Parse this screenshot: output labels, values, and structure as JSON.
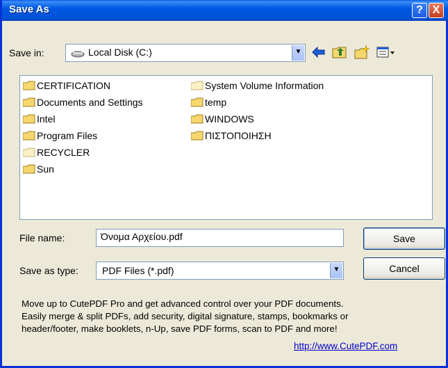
{
  "title": "Save As",
  "titlebar_buttons": {
    "help": "?",
    "close": "X"
  },
  "save_in": {
    "label": "Save in:",
    "value": "Local Disk (C:)"
  },
  "toolbar_icons": [
    "back-arrow-icon",
    "up-one-level-icon",
    "new-folder-icon",
    "view-menu-icon"
  ],
  "folders": [
    {
      "name": "CERTIFICATION"
    },
    {
      "name": "Documents and Settings"
    },
    {
      "name": "Intel"
    },
    {
      "name": "Program Files"
    },
    {
      "name": "RECYCLER"
    },
    {
      "name": "Sun"
    },
    {
      "name": "System Volume Information"
    },
    {
      "name": "temp"
    },
    {
      "name": "WINDOWS"
    },
    {
      "name": "ΠΙΣΤΟΠΟΙΗΣΗ"
    }
  ],
  "file_name": {
    "label": "File name:",
    "value": "Όνομα Αρχείου.pdf"
  },
  "save_as_type": {
    "label": "Save as type:",
    "value": "PDF Files (*.pdf)"
  },
  "buttons": {
    "save": "Save",
    "cancel": "Cancel"
  },
  "info": {
    "line1": "Move up to CutePDF Pro and get advanced control over your PDF documents.",
    "line2": "Easily merge & split PDFs, add security, digital signature, stamps, bookmarks or",
    "line3": "header/footer, make booklets, n-Up, save PDF forms, scan to PDF and more!"
  },
  "link": "http://www.CutePDF.com"
}
